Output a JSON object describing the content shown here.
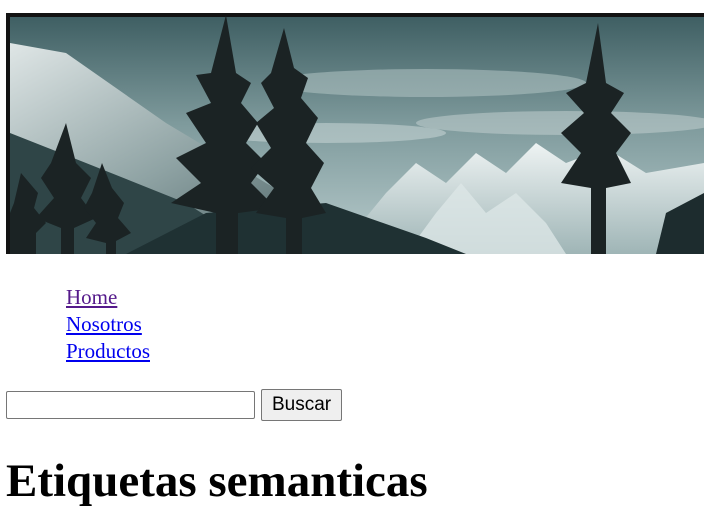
{
  "header": {
    "banner_image": "mountain-forest-landscape"
  },
  "nav": {
    "items": [
      {
        "label": "Home",
        "visited": true
      },
      {
        "label": "Nosotros",
        "visited": false
      },
      {
        "label": "Productos",
        "visited": false
      }
    ]
  },
  "search": {
    "value": "",
    "button_label": "Buscar"
  },
  "main": {
    "title": "Etiquetas semanticas"
  },
  "colors": {
    "link": "#0000ee",
    "visited_link": "#551a8b",
    "button_bg": "#efefef"
  }
}
